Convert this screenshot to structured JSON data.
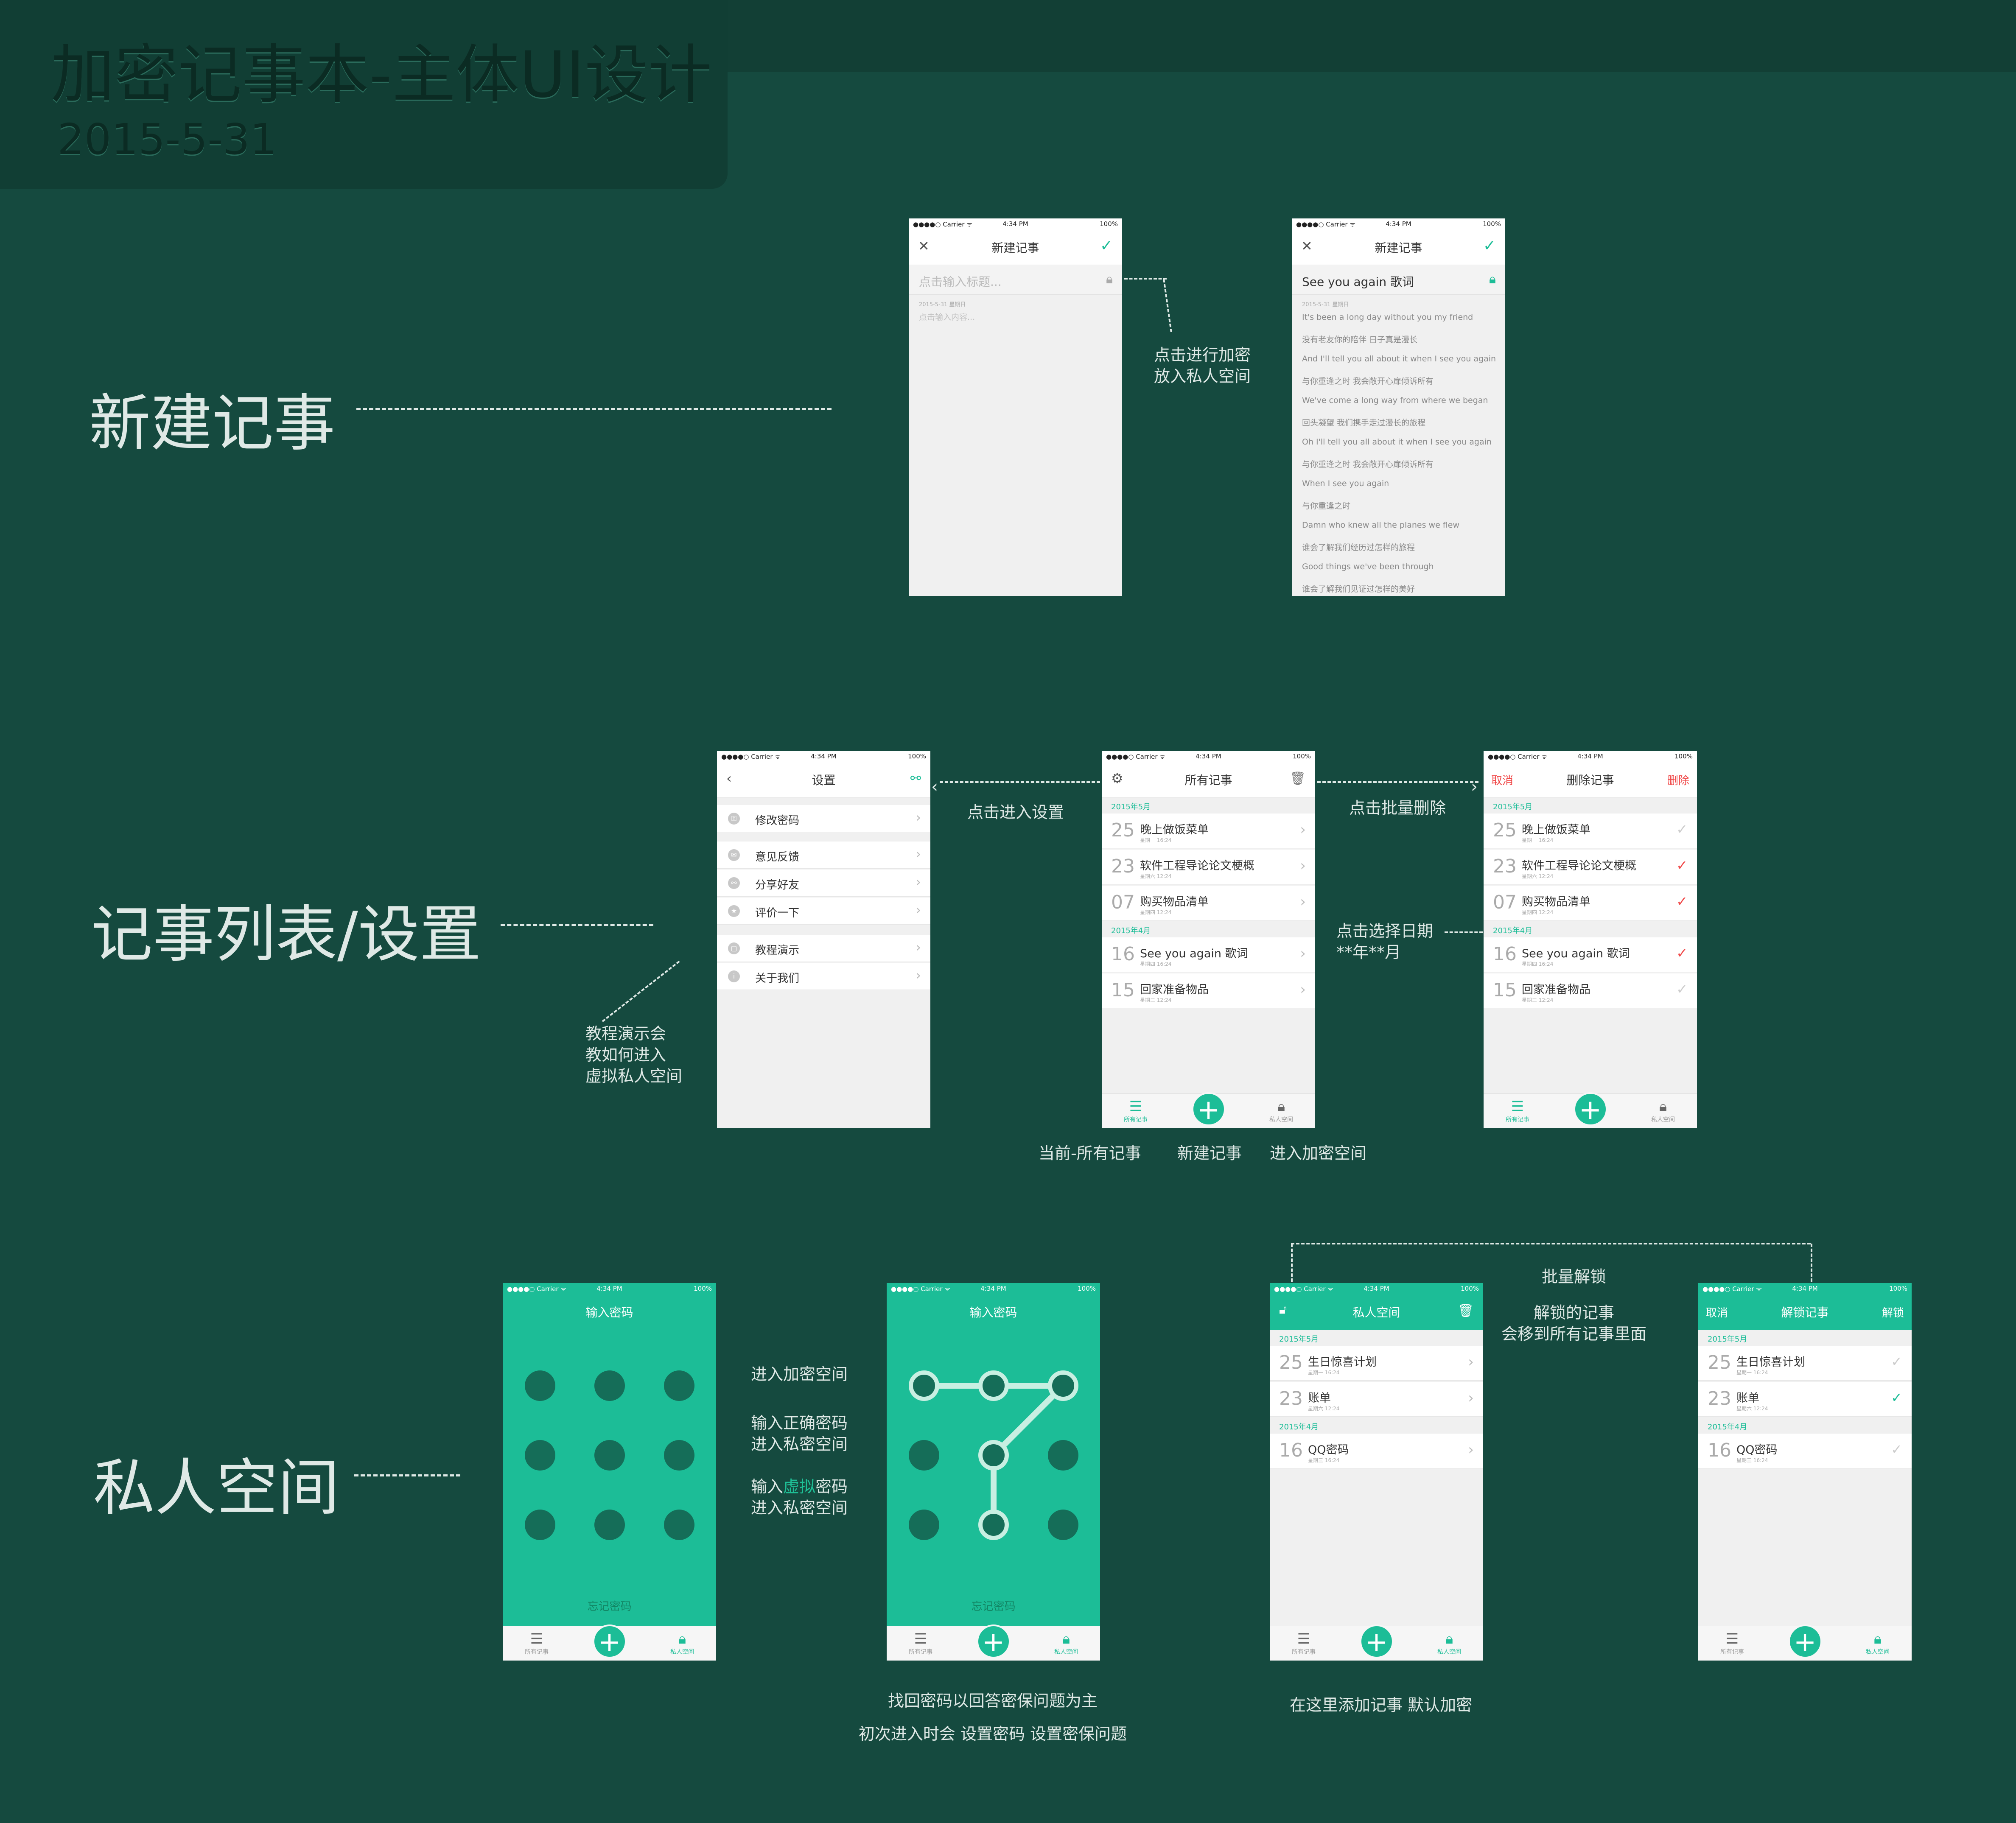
{
  "header": {
    "title": "加密记事本-主体UI设计",
    "date": "2015-5-31"
  },
  "sections": {
    "new_note": "新建记事",
    "list_settings": "记事列表/设置",
    "private": "私人空间"
  },
  "status": {
    "carrier": "●●●●○ Carrier ᯤ",
    "time": "4:34 PM",
    "battery": "100%"
  },
  "annotations": {
    "encrypt": [
      "点击进行加密",
      "放入私人空间"
    ],
    "enter_settings": "点击进入设置",
    "batch_delete": "点击批量删除",
    "select_date": [
      "点击选择日期",
      "**年**月"
    ],
    "tutorial": [
      "教程演示会",
      "教如何进入",
      "虚拟私人空间"
    ],
    "bottom_current": "当前-所有记事",
    "bottom_new": "新建记事",
    "bottom_enter": "进入加密空间",
    "enter_space": "进入加密空间",
    "correct_pwd": [
      "输入正确密码",
      "进入私密空间"
    ],
    "virtual_pwd_a": "输入",
    "virtual_pwd_hl": "虚拟",
    "virtual_pwd_b": "密码",
    "virtual_pwd_2": "进入私密空间",
    "recover": [
      "找回密码以回答密保问题为主",
      "初次进入时会  设置密码  设置密保问题"
    ],
    "batch_unlock": "批量解锁",
    "unlocked": [
      "解锁的记事",
      "会移到所有记事里面"
    ],
    "add_here": "在这里添加记事  默认加密"
  },
  "phone_new_empty": {
    "title": "新建记事",
    "title_placeholder": "点击输入标题...",
    "date": "2015-5-31  星期日",
    "content_placeholder": "点击输入内容..."
  },
  "phone_new_filled": {
    "title": "新建记事",
    "note_title": "See you again 歌词",
    "date": "2015-5-31  星期日",
    "lines": [
      "It's been a long day without you my friend",
      "没有老友你的陪伴 日子真是漫长",
      "And I'll tell you all about it when I see you again",
      "与你重逢之时 我会敞开心扉倾诉所有",
      "We've come a long way from where we began",
      "回头凝望 我们携手走过漫长的旅程",
      "Oh I'll tell you all about it when I see you again",
      "与你重逢之时 我会敞开心扉倾诉所有",
      "When I see you again",
      "与你重逢之时",
      "Damn who knew all the planes we flew",
      "谁会了解我们经历过怎样的旅程",
      "Good things we've been through",
      "谁会了解我们见证过怎样的美好"
    ]
  },
  "phone_settings": {
    "title": "设置",
    "items": [
      "修改密码",
      "意见反馈",
      "分享好友",
      "评价一下",
      "教程演示",
      "关于我们"
    ]
  },
  "phone_all": {
    "title": "所有记事",
    "sec1": "2015年5月",
    "sec2": "2015年4月",
    "notes": [
      {
        "d": "25",
        "n": "晚上做饭菜单",
        "s": "星期一  16:24"
      },
      {
        "d": "23",
        "n": "软件工程导论论文梗概",
        "s": "星期六  12:24"
      },
      {
        "d": "07",
        "n": "购买物品清单",
        "s": "星期四  12:24"
      },
      {
        "d": "16",
        "n": "See you again 歌词",
        "s": "星期四  16:24"
      },
      {
        "d": "15",
        "n": "回家准备物品",
        "s": "星期三  12:24"
      }
    ]
  },
  "phone_delete": {
    "cancel": "取消",
    "title": "删除记事",
    "delete": "删除"
  },
  "tabbar": {
    "all": "所有记事",
    "private": "私人空间"
  },
  "phone_lock": {
    "title": "输入密码",
    "forgot": "忘记密码"
  },
  "phone_private": {
    "title": "私人空间",
    "notes": [
      {
        "d": "25",
        "n": "生日惊喜计划",
        "s": "星期一  16:24"
      },
      {
        "d": "23",
        "n": "账单",
        "s": "星期六  12:24"
      },
      {
        "d": "16",
        "n": "QQ密码",
        "s": "星期三  16:24"
      }
    ]
  },
  "phone_unlock": {
    "cancel": "取消",
    "title": "解锁记事",
    "unlock": "解锁"
  }
}
